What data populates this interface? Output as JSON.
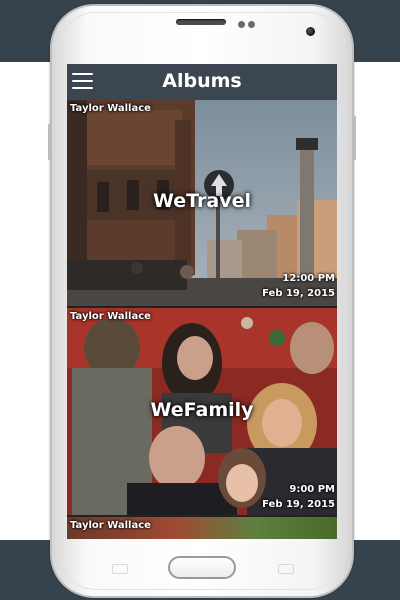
{
  "header": {
    "title": "Albums"
  },
  "icons": {
    "menu": "hamburger-menu-icon"
  },
  "colors": {
    "header_bg": "#3b4650",
    "page_band": "#36434d",
    "text": "#ffffff"
  },
  "albums": [
    {
      "owner": "Taylor Wallace",
      "title": "WeTravel",
      "time": "12:00 PM",
      "date": "Feb 19, 2015"
    },
    {
      "owner": "Taylor Wallace",
      "title": "WeFamily",
      "time": "9:00 PM",
      "date": "Feb 19, 2015"
    },
    {
      "owner": "Taylor Wallace"
    }
  ]
}
